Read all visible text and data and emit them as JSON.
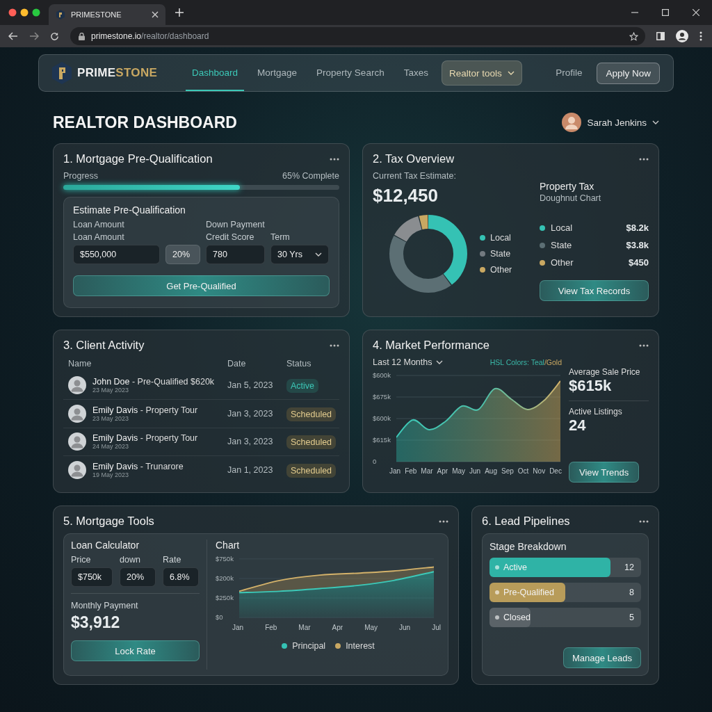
{
  "browser": {
    "tab_title": "PRIMESTONE",
    "url_host": "primestone.io",
    "url_path": "/realtor/dashboard"
  },
  "nav": {
    "brand_a": "PRIME",
    "brand_b": "STONE",
    "links": [
      {
        "label": "Dashboard",
        "selected": true
      },
      {
        "label": "Mortgage",
        "selected": false
      },
      {
        "label": "Property Search",
        "selected": false
      },
      {
        "label": "Taxes",
        "selected": false
      }
    ],
    "tools": "Realtor tools",
    "profile": "Profile",
    "apply": "Apply Now"
  },
  "page": {
    "title": "REALTOR DASHBOARD",
    "user": "Sarah Jenkins"
  },
  "prequal": {
    "title": "1. Mortgage Pre-Qualification",
    "progress_label": "Progress",
    "progress_text": "65% Complete",
    "level": 0.64,
    "form_title": "Estimate Pre-Qualification",
    "labels_top": [
      "Loan Amount",
      "Down Payment"
    ],
    "labels": [
      "Loan Amount",
      "Credit Score",
      "Term"
    ],
    "fields": [
      {
        "kind": "input",
        "value": "$550,000"
      },
      {
        "kind": "addon",
        "value": "20%"
      },
      {
        "kind": "input",
        "value": "780"
      },
      {
        "kind": "select",
        "value": "30 Yrs"
      }
    ],
    "button": "Get Pre-Qualified"
  },
  "tax": {
    "title": "2. Tax Overview",
    "estimate_label": "Current Tax Estimate:",
    "estimate": "$12,450",
    "legend": [
      {
        "label": "Local",
        "color": "#35c2b4"
      },
      {
        "label": "State",
        "color": "#737a80"
      },
      {
        "label": "Other",
        "color": "#c9a862"
      }
    ],
    "side_title": "Property Tax",
    "side_subtitle": "Doughnut Chart",
    "breakdown": [
      {
        "label": "Local",
        "value": "$8.2k",
        "color": "#35c2b4"
      },
      {
        "label": "State",
        "value": "$3.8k",
        "color": "#5c6f74"
      },
      {
        "label": "Other",
        "value": "$450",
        "color": "#c9a862"
      }
    ],
    "button": "View Tax Records"
  },
  "clients": {
    "title": "3. Client Activity",
    "columns": [
      "Name",
      "Date",
      "Status"
    ],
    "rows": [
      {
        "name": "John Doe",
        "activity": "- Pre-Qualified $620k",
        "sub": "23 May 2023",
        "date": "Jan 5, 2023",
        "status": "Active",
        "kind": "active"
      },
      {
        "name": "Emily Davis",
        "activity": "- Property Tour",
        "sub": "23 May 2023",
        "date": "Jan 3, 2023",
        "status": "Scheduled",
        "kind": "scheduled"
      },
      {
        "name": "Emily Davis",
        "activity": "- Property Tour",
        "sub": "24 May 2023",
        "date": "Jan 3, 2023",
        "status": "Scheduled",
        "kind": "scheduled"
      },
      {
        "name": "Emily Davis",
        "activity": "- Trunarore",
        "sub": "19 May 2023",
        "date": "Jan 1, 2023",
        "status": "Scheduled",
        "kind": "scheduled"
      }
    ]
  },
  "market": {
    "title": "4. Market Performance",
    "range": "Last 12 Months",
    "note": [
      {
        "text": "HSL Colors: Teal",
        "color": "#3ab8a8"
      },
      {
        "text": "/Gold",
        "color": "#c9a862"
      }
    ],
    "y_labels": [
      "$600k",
      "$675k",
      "$600k",
      "$615k",
      "0"
    ],
    "x_labels": [
      "Jan",
      "Feb",
      "Mar",
      "Apr",
      "May",
      "Jun",
      "Aug",
      "Sep",
      "Oct",
      "Nov",
      "Dec"
    ],
    "stats": [
      {
        "label": "Average Sale Price",
        "value": "$615k"
      },
      {
        "label": "Active Listings",
        "value": "24"
      }
    ],
    "button": "View Trends"
  },
  "tools": {
    "title": "5. Mortgage Tools",
    "calc_title": "Loan Calculator",
    "fields": [
      {
        "label": "Price",
        "value": "$750k"
      },
      {
        "label": "down",
        "value": "20%"
      },
      {
        "label": "Rate",
        "value": "6.8%"
      }
    ],
    "payment_label": "Monthly Payment",
    "payment": "$3,912",
    "button": "Lock Rate",
    "chart_title": "Chart",
    "y_labels": [
      "$750k",
      "$200k",
      "$250k",
      "$0"
    ],
    "x_labels": [
      "Jan",
      "Feb",
      "Mar",
      "Apr",
      "May",
      "Jun",
      "Jul"
    ],
    "legend": [
      {
        "label": "Principal",
        "color": "#35c2b4"
      },
      {
        "label": "Interest",
        "color": "#c9a862"
      }
    ]
  },
  "leads": {
    "title": "6. Lead Pipelines",
    "subtitle": "Stage Breakdown",
    "stages": [
      {
        "label": "Active",
        "count": "12",
        "level": 0.8,
        "color": "#2fb3a6"
      },
      {
        "label": "Pre-Qualified",
        "count": "8",
        "level": 0.5,
        "color": "#b89c5a"
      },
      {
        "label": "Closed",
        "count": "5",
        "level": 0.27,
        "color": "#5b6368"
      }
    ],
    "button": "Manage Leads"
  }
}
